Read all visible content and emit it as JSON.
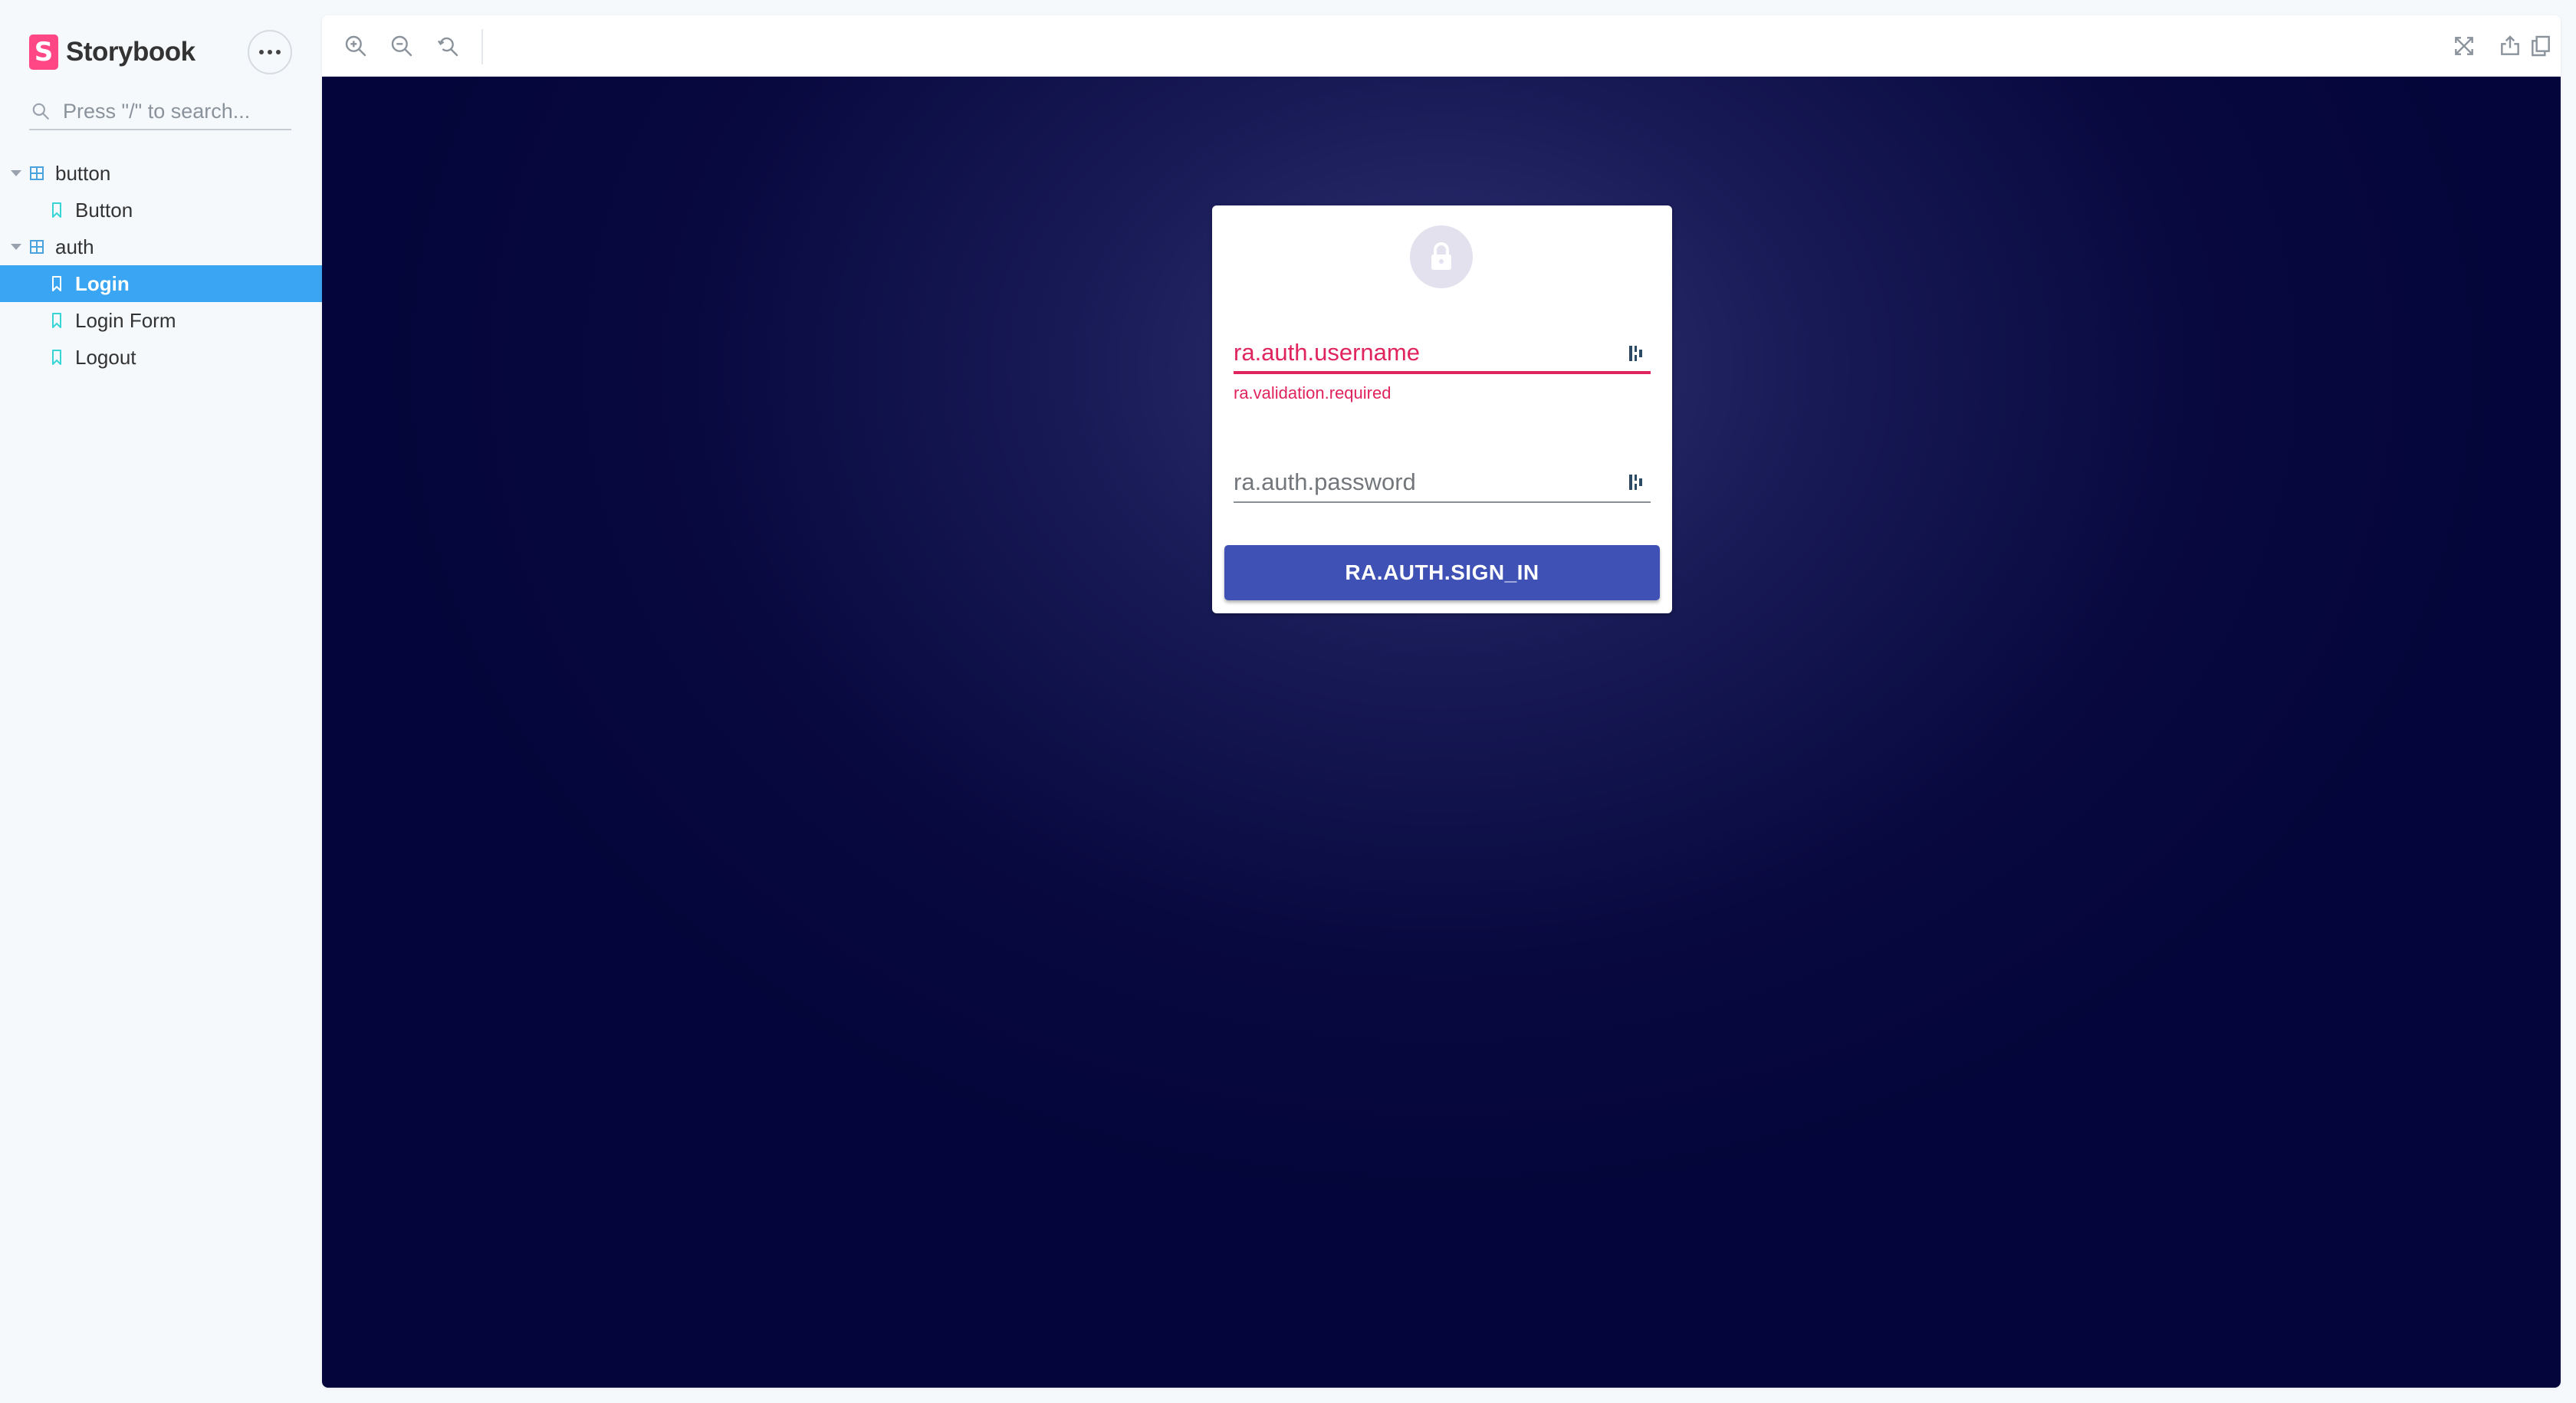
{
  "sidebar": {
    "brand": "Storybook",
    "brand_logo_letter": "S",
    "search_placeholder": "Press \"/\" to search...",
    "tree": [
      {
        "label": "button",
        "type": "group"
      },
      {
        "label": "Button",
        "type": "story"
      },
      {
        "label": "auth",
        "type": "group"
      },
      {
        "label": "Login",
        "type": "story",
        "selected": true
      },
      {
        "label": "Login Form",
        "type": "story"
      },
      {
        "label": "Logout",
        "type": "story"
      }
    ]
  },
  "login": {
    "username_label": "ra.auth.username",
    "username_error": "ra.validation.required",
    "password_label": "ra.auth.password",
    "signin_label": "RA.AUTH.SIGN_IN"
  },
  "colors": {
    "selected": "#3aa5f2",
    "brand": "#ff4785",
    "error": "#e0245e",
    "primary": "#3f51b5"
  },
  "icons": {
    "toolbar_left": [
      "zoom-in-icon",
      "zoom-out-icon",
      "reset-zoom-icon"
    ],
    "toolbar_right": [
      "fullscreen-icon",
      "share-icon",
      "copy-icon"
    ]
  }
}
